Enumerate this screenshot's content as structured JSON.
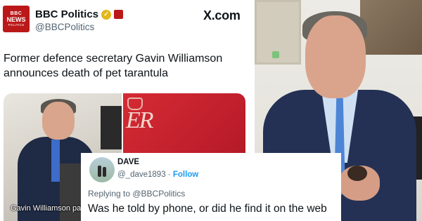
{
  "post": {
    "logo": {
      "line1": "BBC",
      "line2": "NEWS",
      "line3": "POLITICS",
      "color": "#bb1919"
    },
    "account_name": "BBC Politics",
    "handle": "@BBCPolitics",
    "site": "X.com",
    "text": "Former defence secretary Gavin Williamson announces death of pet tarantula",
    "photo_caption": "Gavin Williamson pays"
  },
  "reply": {
    "name": "DAVE",
    "handle": "@_dave1893",
    "separator": " · ",
    "follow_label": "Follow",
    "replying_to": "Replying to @BBCPolitics",
    "text": "Was he told by phone, or did he find it on the web"
  },
  "colors": {
    "accent": "#1d9bf0",
    "muted": "#536471",
    "brand": "#bb1919"
  }
}
